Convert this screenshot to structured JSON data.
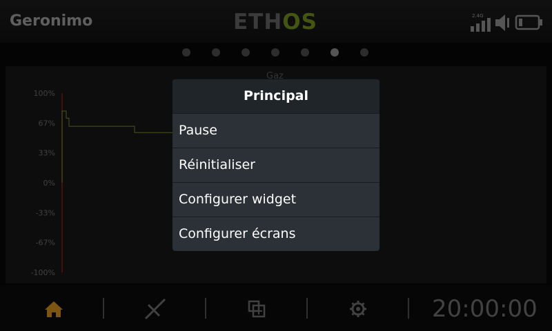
{
  "header": {
    "model_name": "Geronimo",
    "logo_part1": "ETH",
    "logo_part2": "OS",
    "radio_band": "2.4G"
  },
  "pager": {
    "pages": 7,
    "active_index": 5
  },
  "widget": {
    "title": "Gaz",
    "y_ticks": [
      "100%",
      "67%",
      "33%",
      "0%",
      "-33%",
      "-67%",
      "-100%"
    ]
  },
  "chart_data": {
    "type": "line",
    "title": "Gaz",
    "ylim": [
      -100,
      100
    ],
    "y_tick_labels": [
      "100%",
      "67%",
      "33%",
      "0%",
      "-33%",
      "-67%",
      "-100%"
    ],
    "series": [
      {
        "points": [
          [
            0,
            0
          ],
          [
            0,
            80
          ],
          [
            6,
            80
          ],
          [
            6,
            72
          ],
          [
            10,
            72
          ],
          [
            10,
            63
          ],
          [
            105,
            63
          ],
          [
            105,
            56
          ],
          [
            160,
            56
          ]
        ]
      }
    ],
    "colors": {
      "line": "#7a8a2a",
      "axis": "#8b1f1f"
    }
  },
  "menu": {
    "title": "Principal",
    "items": [
      "Pause",
      "Réinitialiser",
      "Configurer widget",
      "Configurer écrans"
    ]
  },
  "bottom_bar": {
    "timer": "20:00:00",
    "icons": [
      "home-icon",
      "model-setup-icon",
      "system-icon",
      "settings-icon"
    ]
  },
  "colors": {
    "accent_orange": "#c98a1b",
    "logo_green": "#6f8a1e",
    "menu_bg": "#2b3137",
    "menu_title_bg": "#20252a"
  }
}
